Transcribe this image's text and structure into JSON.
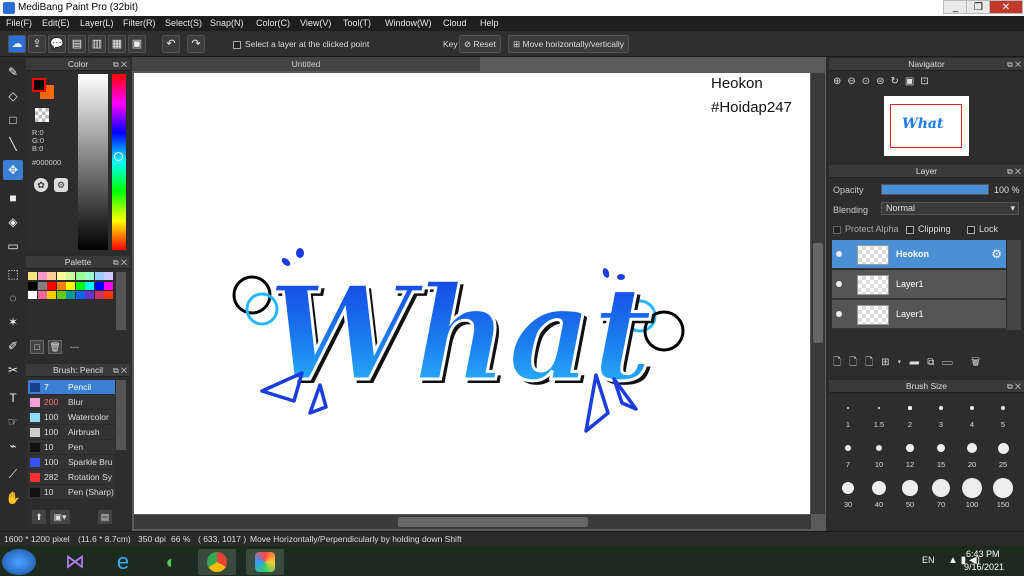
{
  "window": {
    "title": "MediBang Paint Pro (32bit)",
    "buttons": [
      "_",
      "❐",
      "✕"
    ]
  },
  "menu": [
    "File(F)",
    "Edit(E)",
    "Layer(L)",
    "Filter(R)",
    "Select(S)",
    "Snap(N)",
    "Color(C)",
    "View(V)",
    "Tool(T)",
    "Window(W)",
    "Cloud",
    "Help"
  ],
  "toolbar": {
    "select_layer_label": "Select a layer at the clicked point",
    "key_label": "Key",
    "reset_label": "Reset",
    "move_hv_label": "Move horizontally/vertically"
  },
  "document": {
    "tab_title": "Untitled",
    "canvas_text_1": "Heokon",
    "canvas_text_2": "#Hoidap247"
  },
  "color_panel": {
    "title": "Color",
    "r": "R:0",
    "g": "G:0",
    "b": "B:0",
    "hex": "#000000",
    "primary": "#000000",
    "secondary": "#ff6600"
  },
  "palette_panel": {
    "title": "Palette",
    "extra": "---",
    "colors": [
      "#ffe680",
      "#ff99cc",
      "#ffcc99",
      "#ffff99",
      "#ccff99",
      "#99ff99",
      "#99ffcc",
      "#99ccff",
      "#ccccff",
      "#000000",
      "#808080",
      "#ff0000",
      "#ff8000",
      "#ffff00",
      "#00ff00",
      "#00ffff",
      "#0000ff",
      "#ff00ff",
      "#ffffff",
      "#ff6699",
      "#ffcc00",
      "#66cc00",
      "#009999",
      "#0066ff",
      "#6633cc",
      "#cc3366",
      "#ff3300",
      "#ffccff",
      "#ffffcc",
      "#ccffff",
      "#cce5ff",
      "#e5ccff",
      "#ff0066",
      "#00ccff",
      "#cc9966"
    ]
  },
  "brush_panel": {
    "title": "Brush: Pencil",
    "items": [
      {
        "size": "7",
        "name": "Pencil",
        "color": "#1a3c8c"
      },
      {
        "size": "200",
        "name": "Blur",
        "color": "#f5a0d6"
      },
      {
        "size": "100",
        "name": "Watercolor",
        "color": "#8fdcff"
      },
      {
        "size": "100",
        "name": "Airbrush",
        "color": "#cccccc"
      },
      {
        "size": "10",
        "name": "Pen",
        "color": "#111111"
      },
      {
        "size": "100",
        "name": "Sparkle Bru",
        "color": "#3355ff"
      },
      {
        "size": "282",
        "name": "Rotation Sy",
        "color": "#ff3333"
      },
      {
        "size": "10",
        "name": "Pen (Sharp)",
        "color": "#111111"
      }
    ]
  },
  "navigator": {
    "title": "Navigator"
  },
  "layer_panel": {
    "title": "Layer",
    "opacity_label": "Opacity",
    "opacity_value": "100 %",
    "opacity": 1.0,
    "blending_label": "Blending",
    "blending_value": "Normal",
    "protect_alpha": "Protect Alpha",
    "clipping": "Clipping",
    "lock": "Lock",
    "layers": [
      {
        "name": "Heokon",
        "selected": true
      },
      {
        "name": "Layer1",
        "selected": false
      },
      {
        "name": "Layer1",
        "selected": false
      }
    ]
  },
  "brush_size_panel": {
    "title": "Brush Size",
    "sizes": [
      "1",
      "1.5",
      "2",
      "3",
      "4",
      "5",
      "7",
      "10",
      "12",
      "15",
      "20",
      "25",
      "30",
      "40",
      "50",
      "70",
      "100",
      "150"
    ]
  },
  "status": {
    "size": "1600 * 1200 pixel",
    "dims": "(11.6 * 8.7cm)",
    "dpi": "350 dpi",
    "zoom": "66 %",
    "coords": "( 633, 1017 )",
    "hint": "Move Horizontally/Perpendicularly by holding down Shift"
  },
  "taskbar": {
    "lang": "EN",
    "time": "6:43 PM",
    "date": "9/16/2021"
  },
  "art": {
    "word": "What",
    "accent": "#1560e8",
    "light": "#27b6ff"
  }
}
